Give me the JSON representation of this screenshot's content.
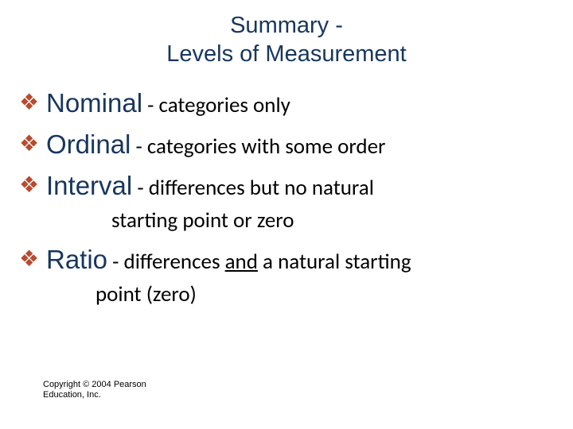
{
  "title_line1": "Summary -",
  "title_line2": "Levels of  Measurement",
  "items": [
    {
      "term": "Nominal",
      "desc": " - categories only",
      "cont": ""
    },
    {
      "term": "Ordinal",
      "desc": " - categories with some order",
      "cont": ""
    },
    {
      "term": "Interval",
      "desc": " - differences but no natural",
      "cont": "starting point or zero"
    },
    {
      "term": "Ratio",
      "desc": " - differences ",
      "desc_underlined": "and",
      "desc2": " a natural starting",
      "cont": "point (zero)"
    }
  ],
  "copyright_line1": "Copyright © 2004 Pearson",
  "copyright_line2": "Education, Inc."
}
